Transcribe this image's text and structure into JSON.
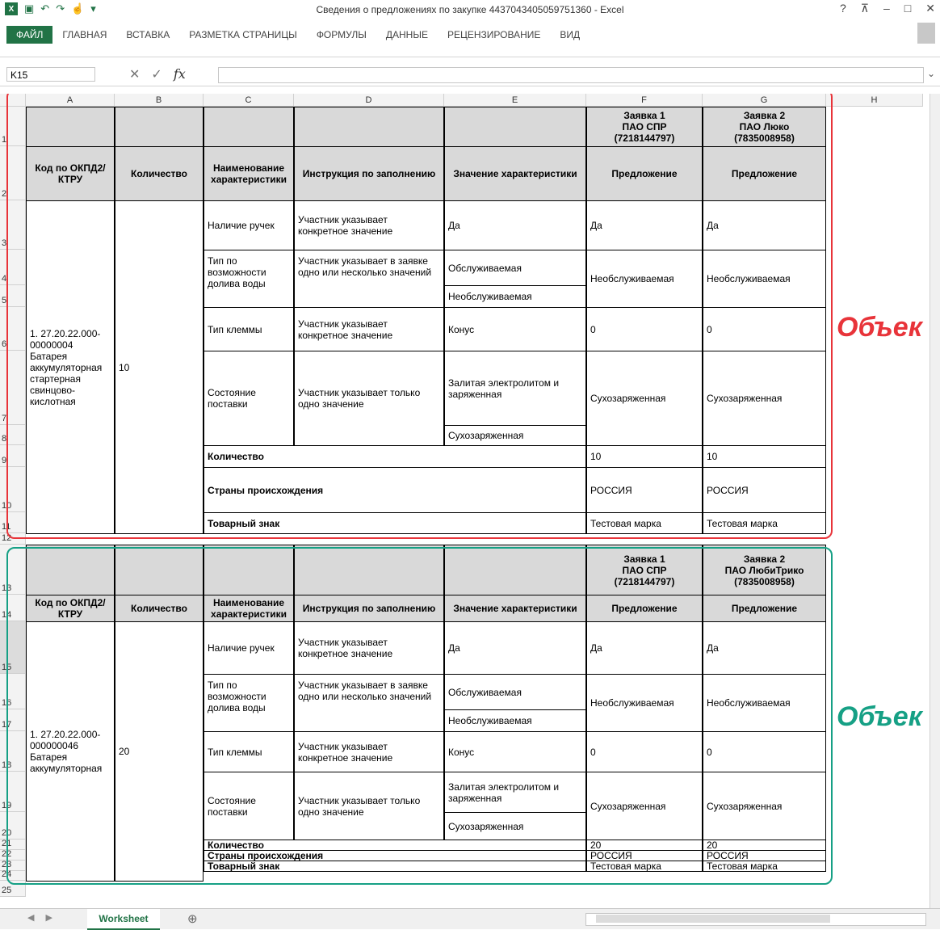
{
  "window": {
    "title": "Сведения о предложениях по закупке 4437043405059751360 - Excel",
    "help": "?",
    "restore_icon": "ribbon-display-icon",
    "minimize": "–",
    "maximize": "□",
    "close": "✕"
  },
  "ribbon": {
    "tabs": [
      "ФАЙЛ",
      "ГЛАВНАЯ",
      "ВСТАВКА",
      "РАЗМЕТКА СТРАНИЦЫ",
      "ФОРМУЛЫ",
      "ДАННЫЕ",
      "РЕЦЕНЗИРОВАНИЕ",
      "ВИД"
    ]
  },
  "formula_bar": {
    "name_box": "K15",
    "cancel": "✕",
    "enter": "✓",
    "fx": "fx",
    "value": ""
  },
  "columns": [
    "A",
    "B",
    "C",
    "D",
    "E",
    "F",
    "G",
    "H"
  ],
  "rows": [
    "1",
    "2",
    "3",
    "4",
    "5",
    "6",
    "7",
    "8",
    "9",
    "10",
    "11",
    "12",
    "13",
    "14",
    "15",
    "16",
    "17",
    "18",
    "19",
    "20",
    "21",
    "22",
    "23",
    "24",
    "25"
  ],
  "block1": {
    "bid1": "Заявка 1\nПАО СПР\n(7218144797)",
    "bid2": "Заявка 2\nПАО Люко\n(7835008958)",
    "h_code": "Код по ОКПД2/КТРУ",
    "h_qty": "Количество",
    "h_name": "Наименование характеристики",
    "h_instr": "Инструкция по заполнению",
    "h_value": "Значение характеристики",
    "h_offer1": "Предложение",
    "h_offer2": "Предложение",
    "code": "1. 27.20.22.000-00000004 Батарея аккумуляторная стартерная свинцово-кислотная",
    "qty": "10",
    "r_handles": {
      "name": "Наличие ручек",
      "instr": "Участник указывает конкретное значение",
      "value": "Да",
      "o1": "Да",
      "o2": "Да"
    },
    "r_type": {
      "name": "Тип по возможности долива воды",
      "instr": "Участник указывает в заявке одно или несколько значений",
      "value1": "Обслуживаемая",
      "value2": "Необслуживаемая",
      "o1": "Необслуживаемая",
      "o2": "Необслуживаемая"
    },
    "r_term": {
      "name": "Тип клеммы",
      "instr": "Участник указывает конкретное значение",
      "value": "Конус",
      "o1": "0",
      "o2": "0"
    },
    "r_state": {
      "name": "Состояние поставки",
      "instr": "Участник указывает только одно значение",
      "value1": "Залитая электролитом и заряженная",
      "value2": "Сухозаряженная",
      "o1": "Сухозаряженная",
      "o2": "Сухозаряженная"
    },
    "f_qty": {
      "label": "Количество",
      "o1": "10",
      "o2": "10"
    },
    "f_country": {
      "label": "Страны происхождения",
      "o1": "РОССИЯ",
      "o2": "РОССИЯ"
    },
    "f_brand": {
      "label": "Товарный знак",
      "o1": "Тестовая марка",
      "o2": "Тестовая марка"
    }
  },
  "block2": {
    "bid1": "Заявка 1\nПАО СПР\n(7218144797)",
    "bid2": "Заявка 2\nПАО ЛюбиТрико\n(7835008958)",
    "h_code": "Код по ОКПД2/КТРУ",
    "h_qty": "Количество",
    "h_name": "Наименование характеристики",
    "h_instr": "Инструкция по заполнению",
    "h_value": "Значение характеристики",
    "h_offer1": "Предложение",
    "h_offer2": "Предложение",
    "code": "1. 27.20.22.000-000000046 Батарея аккумуляторная",
    "qty": "20",
    "r_handles": {
      "name": "Наличие ручек",
      "instr": "Участник указывает конкретное значение",
      "value": "Да",
      "o1": "Да",
      "o2": "Да"
    },
    "r_type": {
      "name": "Тип по возможности долива воды",
      "instr": "Участник указывает в заявке одно или несколько значений",
      "value1": "Обслуживаемая",
      "value2": "Необслуживаемая",
      "o1": "Необслуживаемая",
      "o2": "Необслуживаемая"
    },
    "r_term": {
      "name": "Тип клеммы",
      "instr": "Участник указывает конкретное значение",
      "value": "Конус",
      "o1": "0",
      "o2": "0"
    },
    "r_state": {
      "name": "Состояние поставки",
      "instr": "Участник указывает только одно значение",
      "value1": "Залитая электролитом и заряженная",
      "value2": "Сухозаряженная",
      "o1": "Сухозаряженная",
      "o2": "Сухозаряженная"
    },
    "f_qty": {
      "label": "Количество",
      "o1": "20",
      "o2": "20"
    },
    "f_country": {
      "label": "Страны происхождения",
      "o1": "РОССИЯ",
      "o2": "РОССИЯ"
    },
    "f_brand": {
      "label": "Товарный знак",
      "o1": "Тестовая марка",
      "o2": "Тестовая марка"
    }
  },
  "overlays": {
    "label1": "Объек",
    "label2": "Объек",
    "color1": "#e8343a",
    "color2": "#16a085"
  },
  "sheet": {
    "tab": "Worksheet",
    "add": "⊕"
  },
  "colors": {
    "accent": "#217346",
    "header_fill": "#d9d9d9"
  }
}
